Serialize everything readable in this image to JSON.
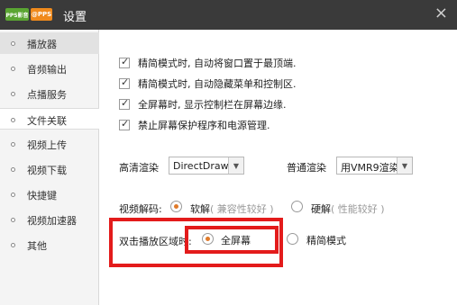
{
  "window": {
    "title": "设置",
    "logo_left": "PPS影音",
    "logo_right": "@PPS",
    "close_glyph": "×"
  },
  "sidebar": {
    "items": [
      {
        "label": "播放器"
      },
      {
        "label": "音频输出"
      },
      {
        "label": "点播服务"
      },
      {
        "label": "文件关联"
      },
      {
        "label": "视频上传"
      },
      {
        "label": "视频下载"
      },
      {
        "label": "快捷键"
      },
      {
        "label": "视频加速器"
      },
      {
        "label": "其他"
      }
    ]
  },
  "options": {
    "checkboxes": [
      {
        "label": "精简模式时, 自动将窗口置于最顶端.",
        "checked": true
      },
      {
        "label": "精简模式时, 自动隐藏菜单和控制区.",
        "checked": true
      },
      {
        "label": "全屏幕时, 显示控制栏在屏幕边缘.",
        "checked": true
      },
      {
        "label": "禁止屏幕保护程序和电源管理.",
        "checked": true
      }
    ],
    "hd_render": {
      "label": "高清渲染",
      "value": "DirectDraw"
    },
    "normal_render": {
      "label": "普通渲染",
      "value": "用VMR9渲染"
    },
    "decode": {
      "label": "视频解码:",
      "soft": {
        "label": "软解",
        "hint": "( 兼容性较好 )",
        "selected": true
      },
      "hard": {
        "label": "硬解",
        "hint": "( 性能较好 )",
        "selected": false
      }
    },
    "dblclick": {
      "label": "双击播放区域时:",
      "fullscreen": {
        "label": "全屏幕",
        "selected": true
      },
      "compact": {
        "label": "精简模式",
        "selected": false
      }
    }
  },
  "colors": {
    "titlebar": "#3a3a3a",
    "highlight": "#e31b1b",
    "radio_accent": "#e07a2a"
  }
}
